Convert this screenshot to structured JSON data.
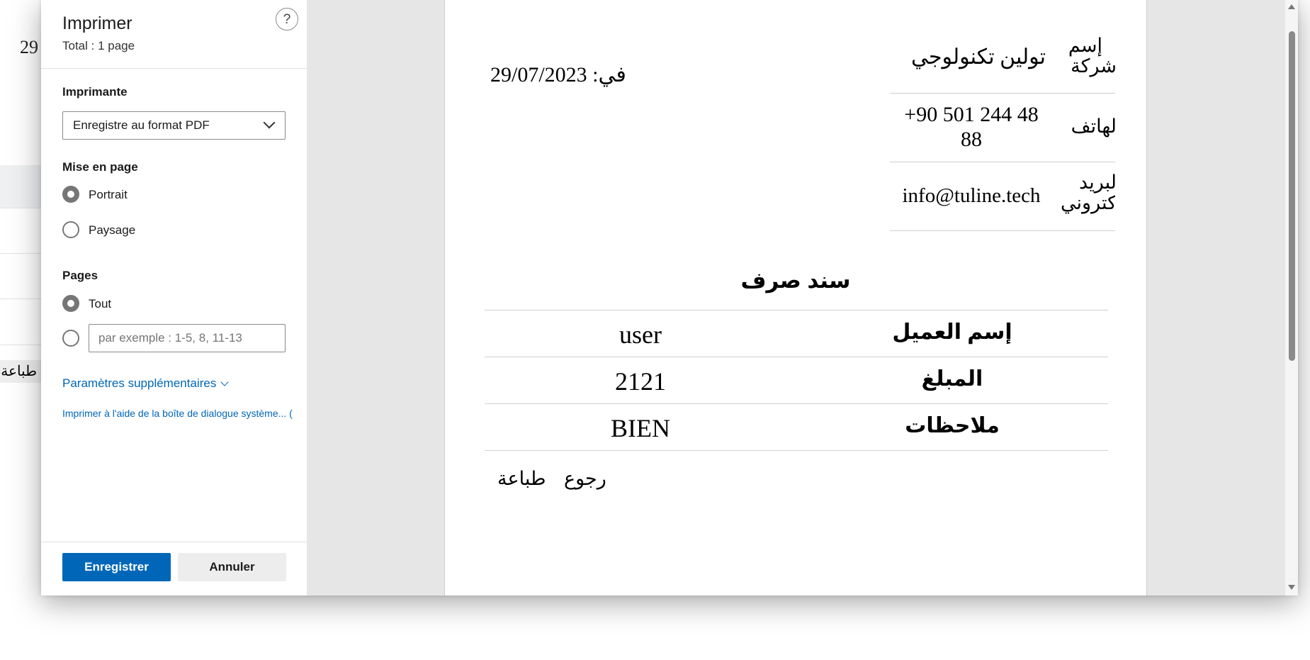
{
  "background": {
    "date_fragment": "29",
    "print_fragment": "طباعة"
  },
  "dialog": {
    "title": "Imprimer",
    "subtitle": "Total : 1 page",
    "help_label": "?",
    "printer": {
      "label": "Imprimante",
      "selected": "Enregistre au format PDF"
    },
    "layout": {
      "label": "Mise en page",
      "options": [
        "Portrait",
        "Paysage"
      ],
      "selected": "Portrait"
    },
    "pages": {
      "label": "Pages",
      "all_label": "Tout",
      "range_placeholder": "par exemple : 1-5, 8, 11-13",
      "selected": "Tout"
    },
    "more_settings": "Paramètres supplémentaires",
    "system_dialog_link": "Imprimer à l'aide de la boîte de dialogue système... (",
    "save_button": "Enregistrer",
    "cancel_button": "Annuler"
  },
  "preview": {
    "date_label": "في:",
    "date_value": "29/07/2023",
    "company": {
      "label_line1": "إسم",
      "label_line2": "شركة",
      "value": "تولين تكنولوجي"
    },
    "phone": {
      "label": "لهاتف",
      "value_line1": "+90 501 244 48",
      "value_line2": "88"
    },
    "email": {
      "label_line1": "لبريد",
      "label_line2": "كتروني",
      "value": "info@tuline.tech"
    },
    "receipt_title": "سند صرف",
    "rows": [
      {
        "label": "إسم العميل",
        "value": "user"
      },
      {
        "label": "المبلغ",
        "value": "2121"
      },
      {
        "label": "ملاحظات",
        "value": "BIEN"
      }
    ],
    "back_label": "رجوع",
    "print_label": "طباعة"
  },
  "colors": {
    "accent": "#0067b8",
    "preview_bg": "#e6e6e6"
  }
}
